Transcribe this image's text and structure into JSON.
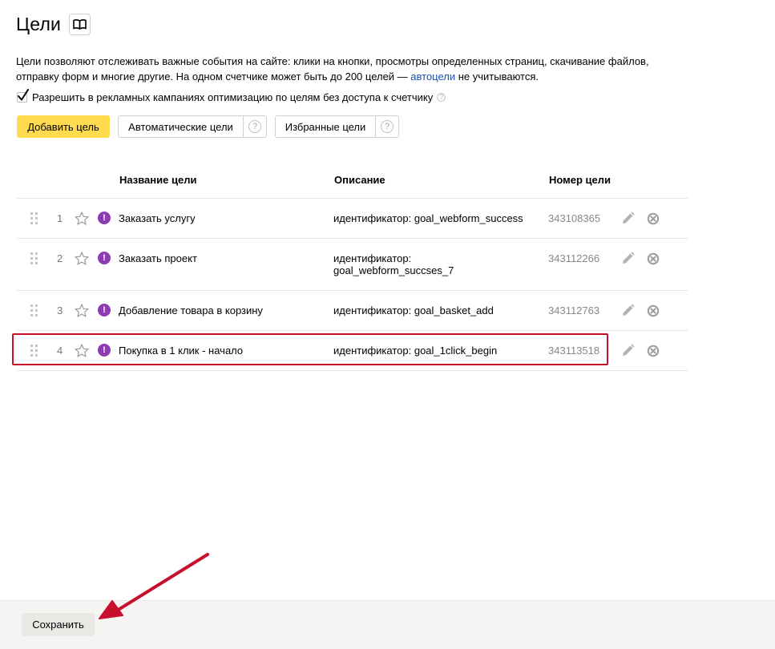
{
  "page": {
    "title": "Цели"
  },
  "intro": {
    "text_before_link": "Цели позволяют отслеживать важные события на сайте: клики на кнопки, просмотры определенных страниц, скачивание файлов, отправку форм и многие другие. На одном счетчике может быть до 200 целей — ",
    "link_text": "автоцели",
    "text_after_link": " не учитываются."
  },
  "permission": {
    "label": "Разрешить в рекламных кампаниях оптимизацию по целям без доступа к счетчику",
    "checked": true,
    "help": "?"
  },
  "toolbar": {
    "add_goal": "Добавить цель",
    "auto_goals": "Автоматические цели",
    "favorite_goals": "Избранные цели",
    "help": "?"
  },
  "table": {
    "headers": {
      "name": "Название цели",
      "description": "Описание",
      "number": "Номер цели"
    },
    "rows": [
      {
        "index": "1",
        "name": "Заказать услугу",
        "desc_line1": "идентификатор: goal_webform_success",
        "desc_line2": "",
        "id": "343108365"
      },
      {
        "index": "2",
        "name": "Заказать проект",
        "desc_line1": "идентификатор:",
        "desc_line2": "goal_webform_succses_7",
        "id": "343112266"
      },
      {
        "index": "3",
        "name": "Добавление товара в корзину",
        "desc_line1": "идентификатор: goal_basket_add",
        "desc_line2": "",
        "id": "343112763"
      },
      {
        "index": "4",
        "name": "Покупка в 1 клик - начало",
        "desc_line1": "идентификатор: goal_1click_begin",
        "desc_line2": "",
        "id": "343113518"
      }
    ],
    "warning_glyph": "!"
  },
  "footer": {
    "save": "Сохранить"
  },
  "colors": {
    "accent_yellow": "#ffdb4d",
    "link_blue": "#1a4fb5",
    "warning_purple": "#8e3cb4",
    "highlight_red": "#c8102e"
  },
  "icons": [
    "book-icon",
    "checkmark-icon",
    "question-icon",
    "drag-handle-icon",
    "star-icon",
    "warning-icon",
    "pencil-icon",
    "delete-icon",
    "arrow-annotation"
  ]
}
